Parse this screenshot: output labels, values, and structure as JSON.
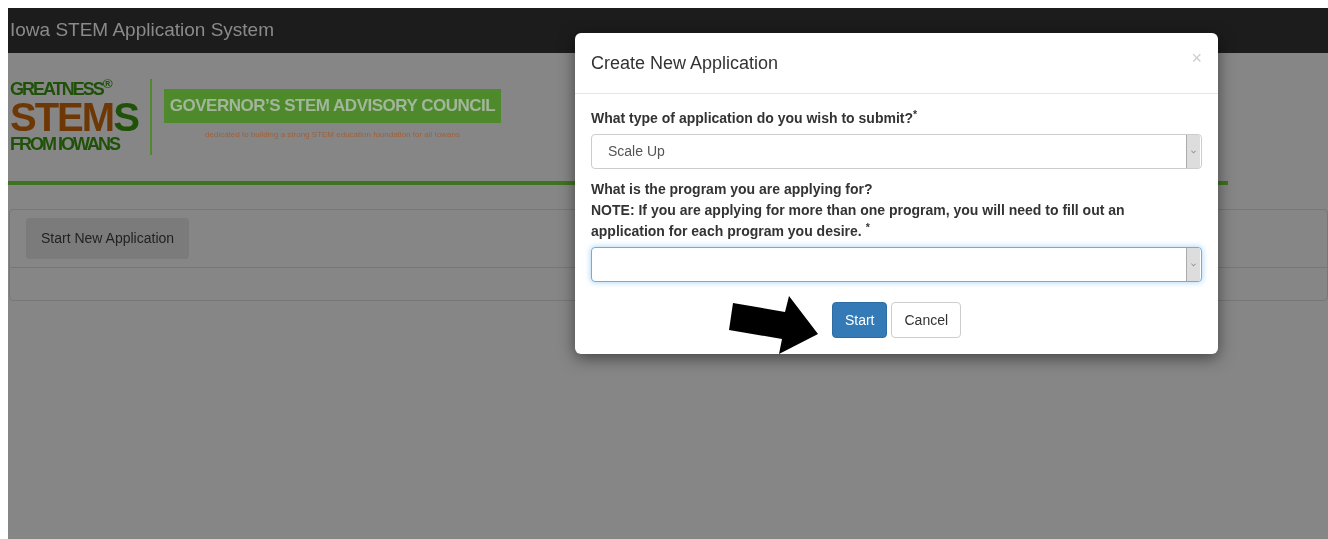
{
  "navbar": {
    "title": "Iowa STEM Application System"
  },
  "logo": {
    "lines": [
      {
        "parts": [
          {
            "text": "GREATNESS$^{®}$",
            "color": "#1f5208"
          }
        ]
      },
      {
        "parts": [
          {
            "text": "STEM",
            "color": "#6e3806"
          },
          {
            "text": "S",
            "color": "#1f5208"
          }
        ]
      },
      {
        "parts": [
          {
            "text": "FROM IOWANS",
            "color": "#1f5208"
          }
        ]
      }
    ],
    "council": "GOVERNOR’S STEM ADVISORY COUNCIL",
    "tagline": "dedicated to building a strong STEM education foundation for all Iowans"
  },
  "panel": {
    "button": "Start New Application"
  },
  "modal": {
    "title": "Create New Application",
    "close": "×",
    "fields": [
      {
        "label": "What type of application do you wish to submit?$^{*}$",
        "value": "Scale Up",
        "focused": false
      },
      {
        "label": "What is the program you are applying for?\nNOTE: If you are applying for more than one program, you will need to fill out an application for each program you desire. $^{*}$",
        "focused": true
      }
    ],
    "buttons": [
      {
        "label": "Start",
        "kind": "primary"
      },
      {
        "label": "Cancel",
        "kind": "default"
      }
    ]
  }
}
